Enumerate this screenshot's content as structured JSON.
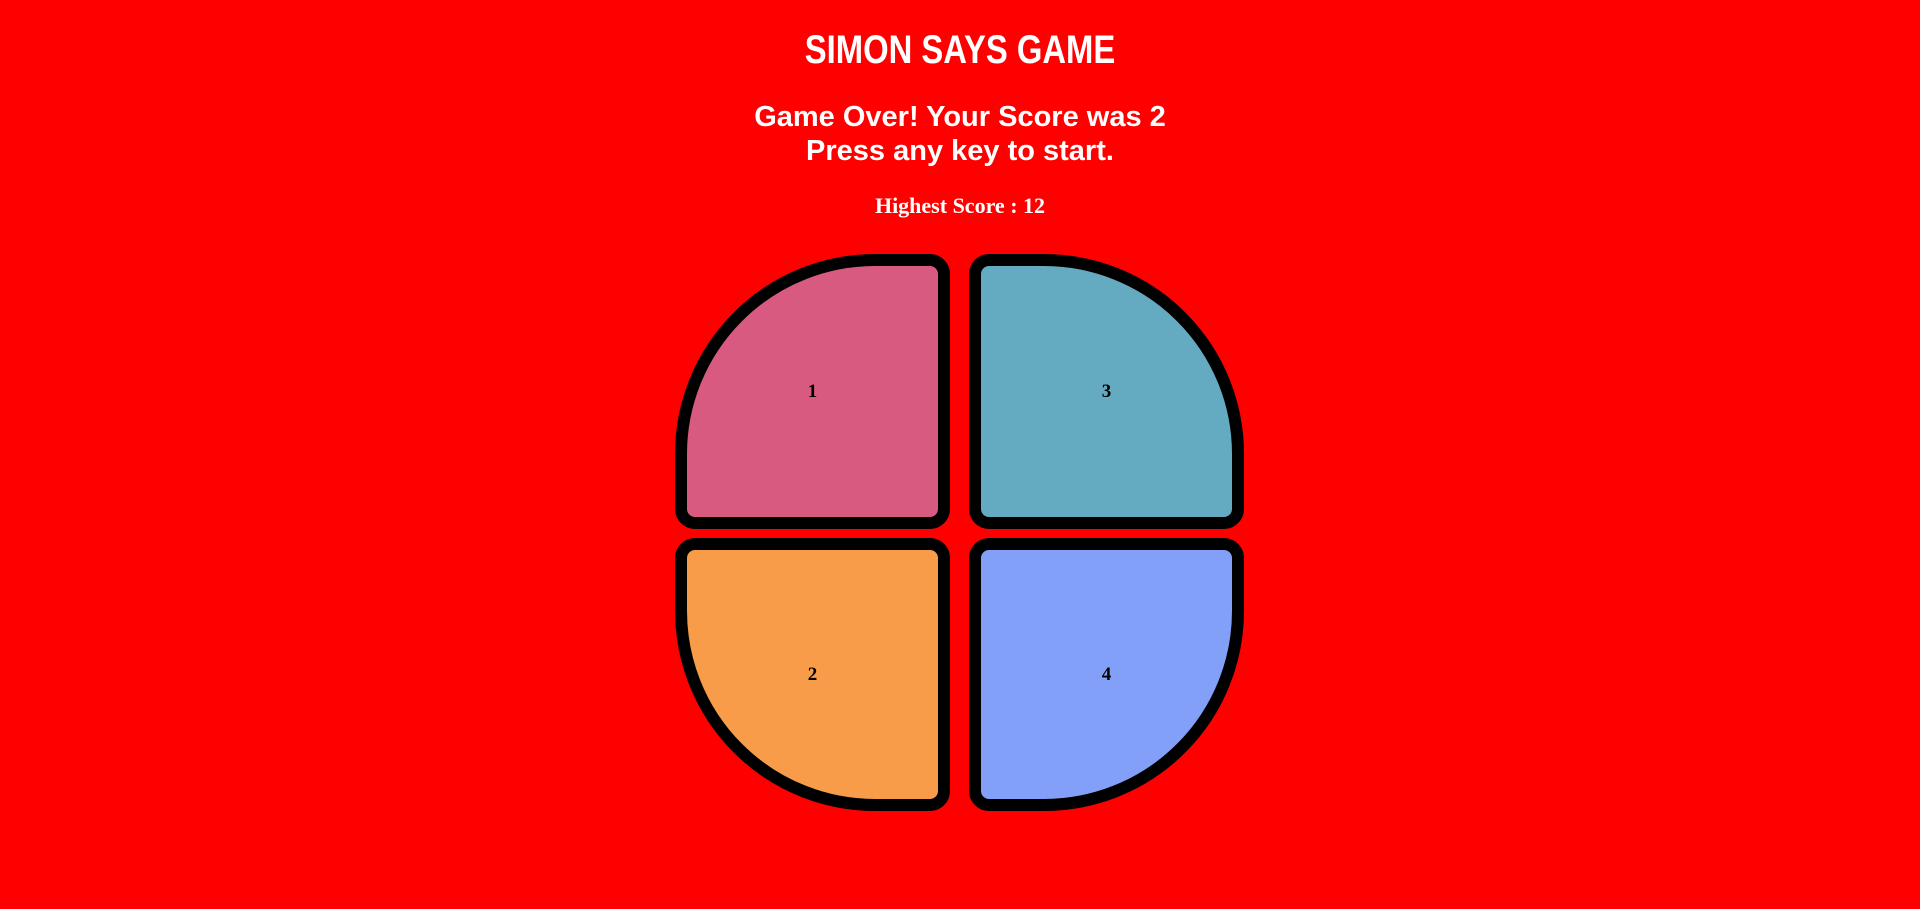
{
  "title": "SIMON SAYS GAME",
  "status": {
    "line1": "Game Over! Your Score was 2",
    "line2": "Press any key to start."
  },
  "highscore": "Highest Score : 12",
  "colors": {
    "background": "#ff0000",
    "pad_1": "#d95a80",
    "pad_2": "#f89c4a",
    "pad_3": "#64aac0",
    "pad_4": "#82a0f8",
    "border": "#000000",
    "text": "#ffffff"
  },
  "pads": [
    {
      "label": "1",
      "color": "#d95a80"
    },
    {
      "label": "2",
      "color": "#f89c4a"
    },
    {
      "label": "3",
      "color": "#64aac0"
    },
    {
      "label": "4",
      "color": "#82a0f8"
    }
  ]
}
